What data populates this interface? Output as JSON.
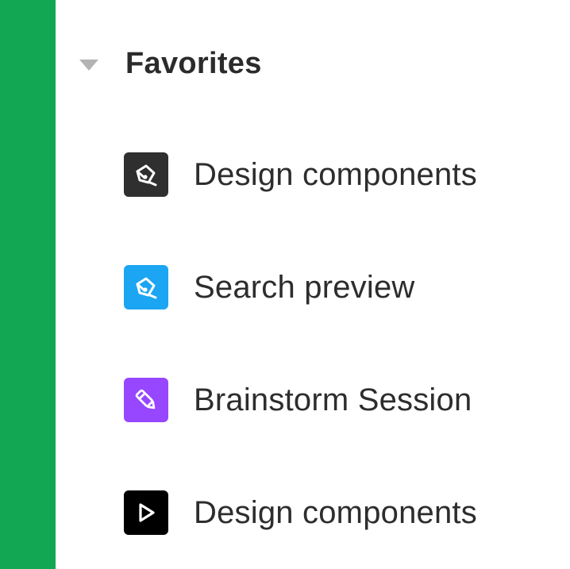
{
  "section": {
    "title": "Favorites",
    "icon": "caret-down-icon",
    "collapsed": false
  },
  "items": [
    {
      "label": "Design components",
      "icon": "pen-tool-icon",
      "icon_bg": "#2f2f2f"
    },
    {
      "label": "Search preview",
      "icon": "pen-tool-icon",
      "icon_bg": "#1ba5f2"
    },
    {
      "label": "Brainstorm Session",
      "icon": "marker-icon",
      "icon_bg": "#9747ff"
    },
    {
      "label": "Design components",
      "icon": "play-icon",
      "icon_bg": "#000000"
    }
  ],
  "colors": {
    "rail": "#12a853",
    "text": "#2d2d2d",
    "caret": "#b3b3b3"
  }
}
